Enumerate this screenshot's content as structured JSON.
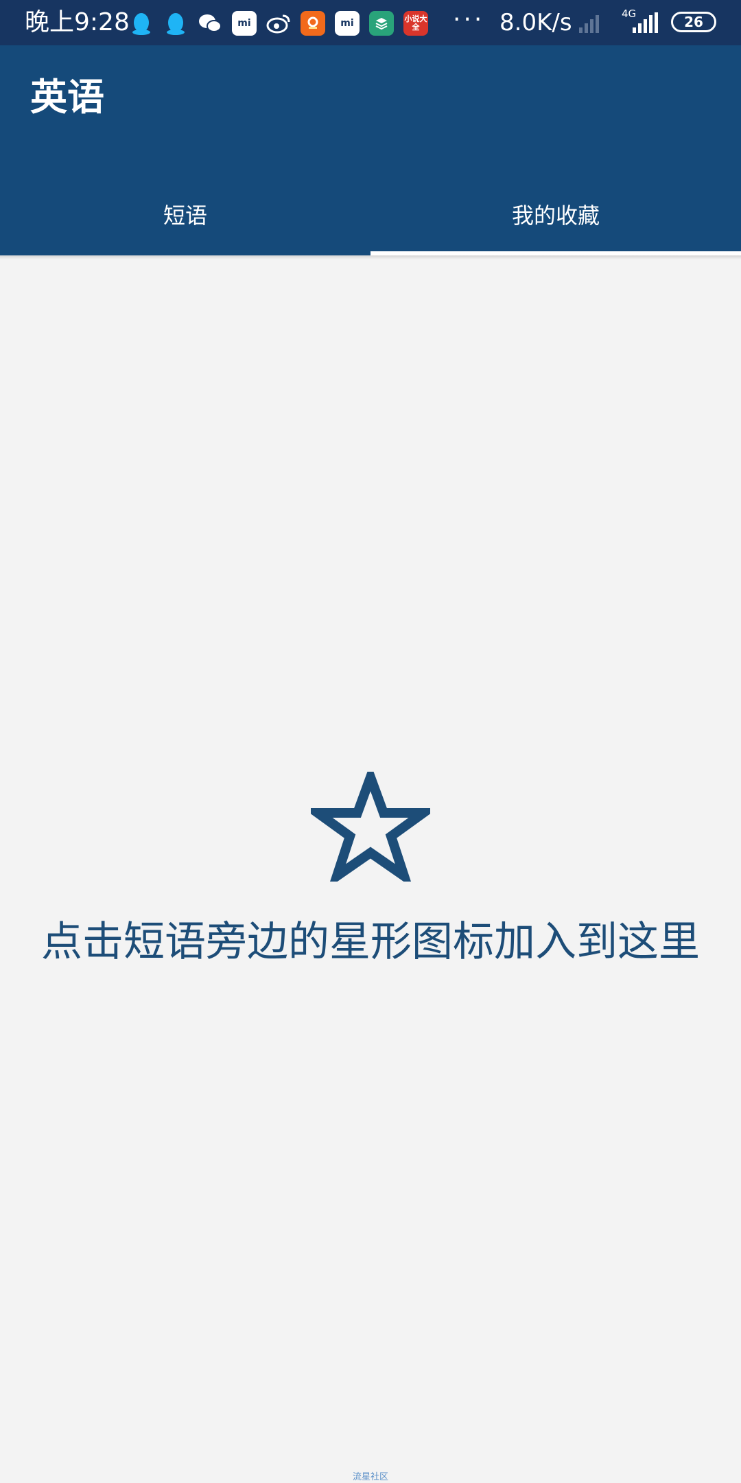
{
  "status_bar": {
    "time": "晚上9:28",
    "more": "···",
    "net_speed": "8.0K/s",
    "network_type": "4G",
    "battery": "26",
    "notification_icons": [
      "qq-icon",
      "qq-icon",
      "wechat-icon",
      "mi-store-icon",
      "weibo-icon",
      "orange-app-icon",
      "mi-store-icon",
      "green-app-icon",
      "novel-app-icon"
    ],
    "mi_label": "mi",
    "novel_label": "小说大全"
  },
  "app_bar": {
    "title": "英语"
  },
  "tabs": [
    {
      "label": "短语",
      "selected": false
    },
    {
      "label": "我的收藏",
      "selected": true
    }
  ],
  "empty_state": {
    "icon": "star-outline-icon",
    "message": "点击短语旁边的星形图标加入到这里"
  },
  "watermark": "流星社区",
  "colors": {
    "status_bar": "#173561",
    "app_bar": "#154a7a",
    "background": "#f3f3f3",
    "accent": "#1d4d78"
  }
}
